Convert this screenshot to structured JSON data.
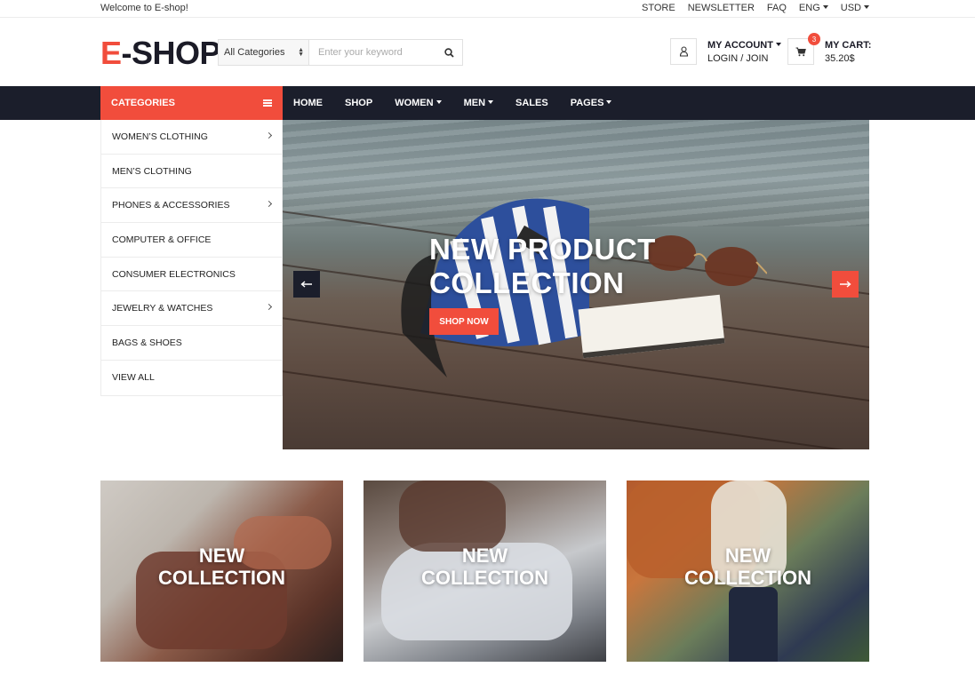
{
  "topbar": {
    "welcome": "Welcome to E-shop!",
    "links": [
      "STORE",
      "NEWSLETTER",
      "FAQ"
    ],
    "language": "ENG",
    "currency": "USD"
  },
  "header": {
    "logo_first": "E",
    "logo_rest": "-SHOP",
    "search": {
      "category_selected": "All Categories",
      "placeholder": "Enter your keyword"
    },
    "account": {
      "title": "MY ACCOUNT",
      "subtitle": "LOGIN / JOIN"
    },
    "cart": {
      "title": "MY CART:",
      "amount": "35.20$",
      "count": "3"
    }
  },
  "nav": {
    "categories_label": "CATEGORIES",
    "links": [
      "HOME",
      "SHOP",
      "WOMEN",
      "MEN",
      "SALES",
      "PAGES"
    ]
  },
  "categories": [
    {
      "label": "WOMEN’S CLOTHING"
    },
    {
      "label": "MEN’S CLOTHING"
    },
    {
      "label": "PHONES & ACCESSORIES"
    },
    {
      "label": "COMPUTER & OFFICE"
    },
    {
      "label": "CONSUMER ELECTRONICS"
    },
    {
      "label": "JEWELRY & WATCHES"
    },
    {
      "label": "BAGS & SHOES"
    },
    {
      "label": "VIEW ALL"
    }
  ],
  "hero": {
    "title_line1": "NEW PRODUCT",
    "title_line2": "COLLECTION",
    "button": "SHOP NOW",
    "prev_icon": "arrow-left-icon",
    "next_icon": "arrow-right-icon"
  },
  "tiles": [
    {
      "line1": "NEW",
      "line2": "COLLECTION"
    },
    {
      "line1": "NEW",
      "line2": "COLLECTION"
    },
    {
      "line1": "NEW",
      "line2": "COLLECTION"
    }
  ],
  "colors": {
    "accent": "#f14d3c",
    "dark": "#1b1e2b"
  }
}
